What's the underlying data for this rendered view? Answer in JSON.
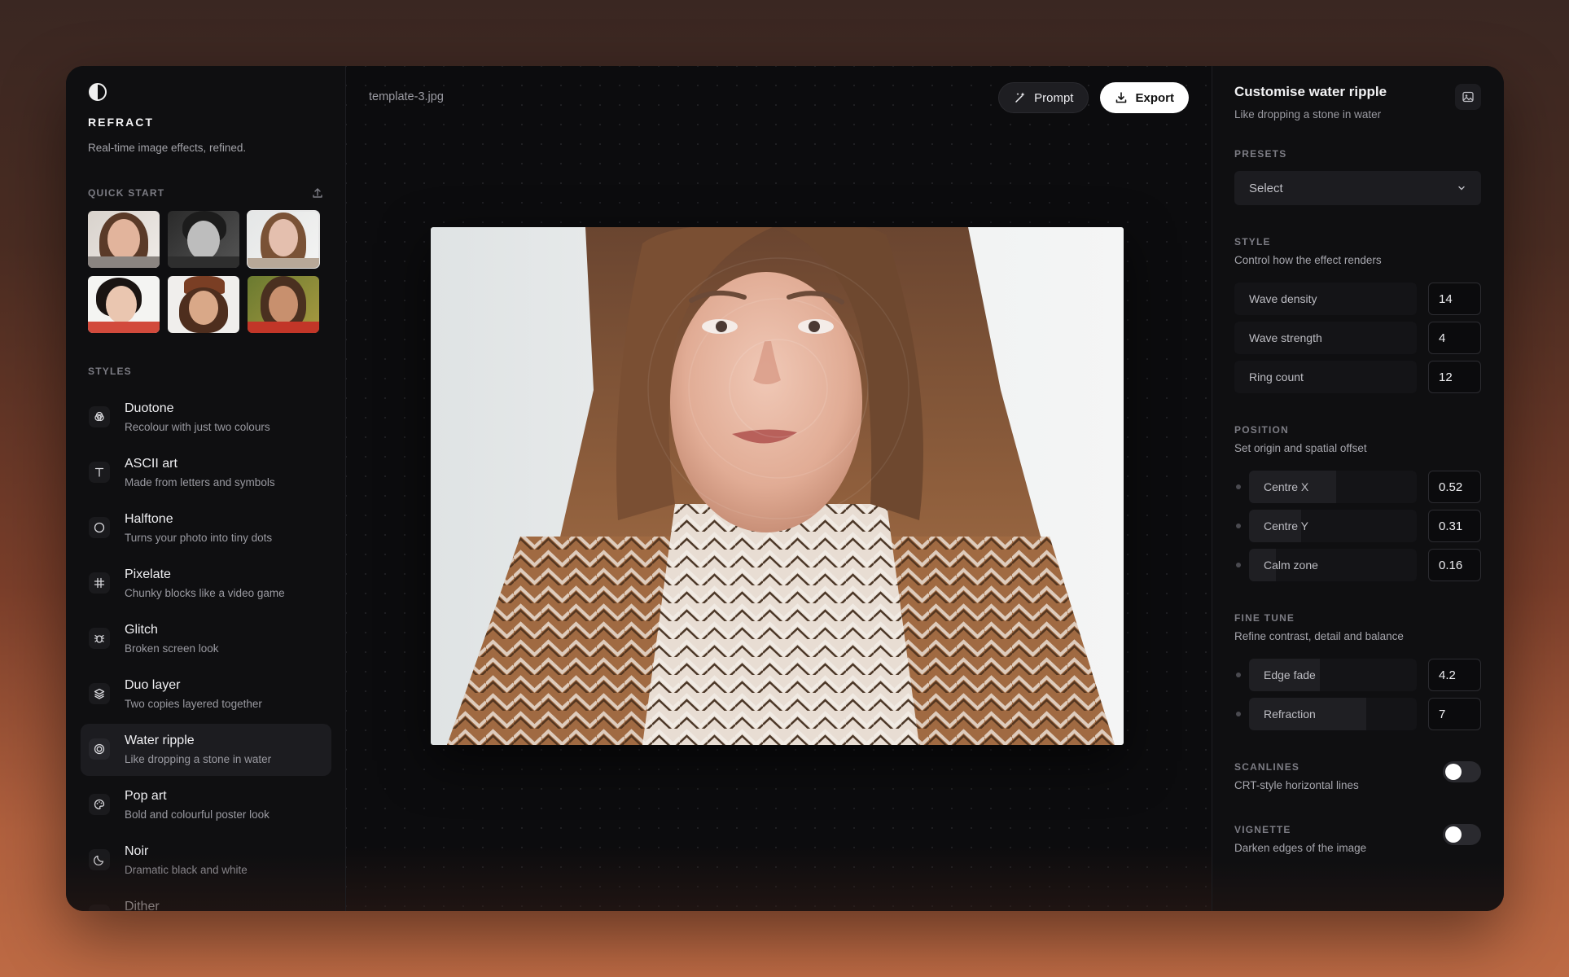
{
  "app": {
    "title": "REFRACT",
    "tagline": "Real-time image effects, refined.",
    "logo_icon": "half-circle-icon"
  },
  "quick_start": {
    "label": "QUICK START",
    "upload_icon": "upload-icon",
    "selected_index": 2
  },
  "styles": {
    "label": "STYLES",
    "items": [
      {
        "name": "Duotone",
        "desc": "Recolour with just two colours",
        "icon": "duotone-circles-icon"
      },
      {
        "name": "ASCII art",
        "desc": "Made from letters and symbols",
        "icon": "text-t-icon"
      },
      {
        "name": "Halftone",
        "desc": "Turns your photo into tiny dots",
        "icon": "circle-icon"
      },
      {
        "name": "Pixelate",
        "desc": "Chunky blocks like a video game",
        "icon": "hash-grid-icon"
      },
      {
        "name": "Glitch",
        "desc": "Broken screen look",
        "icon": "bug-icon"
      },
      {
        "name": "Duo layer",
        "desc": "Two copies layered together",
        "icon": "layers-icon"
      },
      {
        "name": "Water ripple",
        "desc": "Like dropping a stone in water",
        "icon": "ripple-icon"
      },
      {
        "name": "Pop art",
        "desc": "Bold and colourful poster look",
        "icon": "palette-icon"
      },
      {
        "name": "Noir",
        "desc": "Dramatic black and white",
        "icon": "moon-icon"
      },
      {
        "name": "Dither",
        "desc": "",
        "icon": "dither-icon"
      }
    ],
    "active_index": 6
  },
  "canvas": {
    "filename": "template-3.jpg",
    "prompt_label": "Prompt",
    "export_label": "Export"
  },
  "panel": {
    "title": "Customise water ripple",
    "subtitle": "Like dropping a stone in water",
    "presets": {
      "label": "PRESETS",
      "value": "Select"
    },
    "style": {
      "label": "STYLE",
      "desc": "Control how the effect renders",
      "params": [
        {
          "name": "Wave density",
          "value": "14",
          "level": 0.0
        },
        {
          "name": "Wave strength",
          "value": "4",
          "level": 0.0
        },
        {
          "name": "Ring count",
          "value": "12",
          "level": 0.0
        }
      ]
    },
    "position": {
      "label": "POSITION",
      "desc": "Set origin and spatial offset",
      "params": [
        {
          "name": "Centre X",
          "value": "0.52",
          "level": 0.52
        },
        {
          "name": "Centre Y",
          "value": "0.31",
          "level": 0.31
        },
        {
          "name": "Calm zone",
          "value": "0.16",
          "level": 0.16
        }
      ]
    },
    "fine_tune": {
      "label": "FINE TUNE",
      "desc": "Refine contrast, detail and balance",
      "params": [
        {
          "name": "Edge fade",
          "value": "4.2",
          "level": 0.42
        },
        {
          "name": "Refraction",
          "value": "7",
          "level": 0.7
        }
      ]
    },
    "scanlines": {
      "label": "SCANLINES",
      "desc": "CRT-style horizontal lines",
      "enabled": false
    },
    "vignette": {
      "label": "VIGNETTE",
      "desc": "Darken edges of the image",
      "enabled": false
    }
  }
}
